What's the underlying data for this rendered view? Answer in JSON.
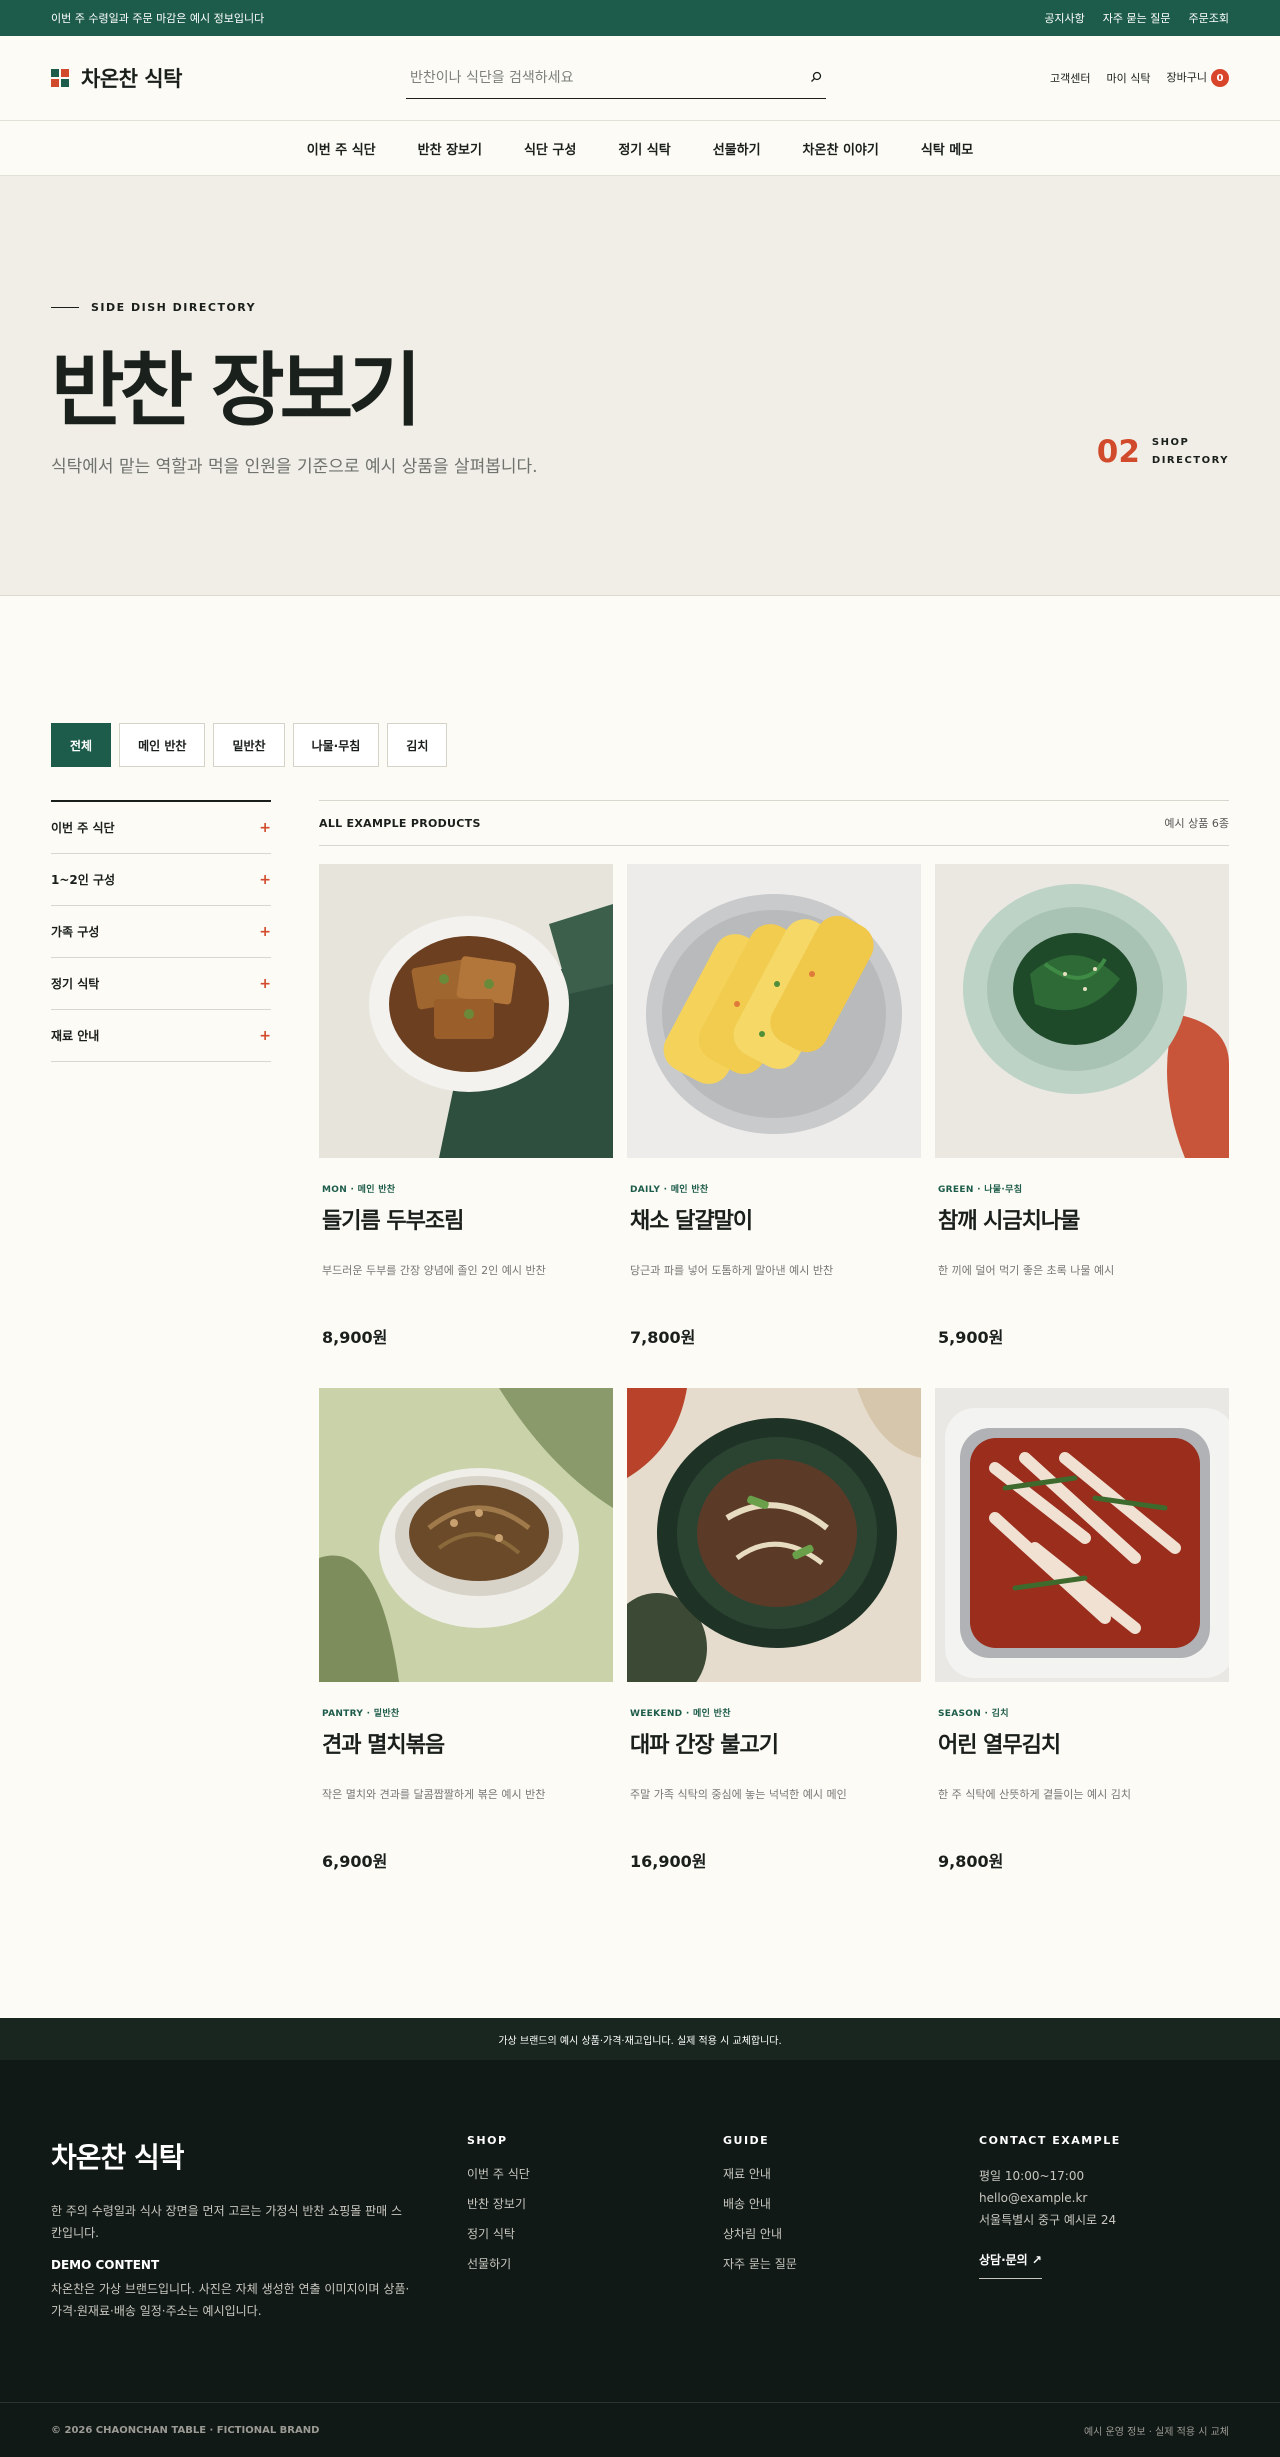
{
  "topbar": {
    "notice": "이번 주 수령일과 주문 마감은 예시 정보입니다",
    "links": [
      "공지사항",
      "자주 묻는 질문",
      "주문조회"
    ]
  },
  "header": {
    "logo": "차온찬 식탁",
    "search_placeholder": "반찬이나 식단을 검색하세요",
    "links": [
      "고객센터",
      "마이 식탁"
    ],
    "cart_label": "장바구니",
    "cart_count": "0"
  },
  "nav": [
    "이번 주 식단",
    "반찬 장보기",
    "식단 구성",
    "정기 식탁",
    "선물하기",
    "차온찬 이야기",
    "식탁 메모"
  ],
  "hero": {
    "eyebrow": "SIDE DISH DIRECTORY",
    "title": "반찬 장보기",
    "subtitle": "식탁에서 맡는 역할과 먹을 인원을 기준으로 예시 상품을 살펴봅니다.",
    "number": "02",
    "number_label_1": "SHOP",
    "number_label_2": "DIRECTORY"
  },
  "filters": [
    "전체",
    "메인 반찬",
    "밑반찬",
    "나물·무침",
    "김치"
  ],
  "sidebar": [
    "이번 주 식단",
    "1~2인 구성",
    "가족 구성",
    "정기 식탁",
    "재료 안내"
  ],
  "list": {
    "heading": "ALL EXAMPLE PRODUCTS",
    "count": "예시 상품 6종"
  },
  "products": [
    {
      "tag": "MON · 메인 반찬",
      "name": "들기름 두부조림",
      "desc": "부드러운 두부를 간장 양념에 졸인 2인 예시 반찬",
      "price": "8,900원",
      "image": "tofu-braised-dish"
    },
    {
      "tag": "DAILY · 메인 반찬",
      "name": "채소 달걀말이",
      "desc": "당근과 파를 넣어 도톰하게 말아낸 예시 반찬",
      "price": "7,800원",
      "image": "rolled-omelette-dish"
    },
    {
      "tag": "GREEN · 나물·무침",
      "name": "참깨 시금치나물",
      "desc": "한 끼에 덜어 먹기 좋은 초록 나물 예시",
      "price": "5,900원",
      "image": "spinach-namul-dish"
    },
    {
      "tag": "PANTRY · 밑반찬",
      "name": "견과 멸치볶음",
      "desc": "작은 멸치와 견과를 달콤짭짤하게 볶은 예시 반찬",
      "price": "6,900원",
      "image": "anchovy-stir-fry-dish"
    },
    {
      "tag": "WEEKEND · 메인 반찬",
      "name": "대파 간장 불고기",
      "desc": "주말 가족 식탁의 중심에 놓는 넉넉한 예시 메인",
      "price": "16,900원",
      "image": "bulgogi-dish"
    },
    {
      "tag": "SEASON · 김치",
      "name": "어린 열무김치",
      "desc": "한 주 식탁에 산뜻하게 곁들이는 예시 김치",
      "price": "9,800원",
      "image": "yeolmu-kimchi-dish"
    }
  ],
  "notice_bar": "가상 브랜드의 예시 상품·가격·재고입니다. 실제 적용 시 교체합니다.",
  "footer": {
    "brand": "차온찬 식탁",
    "desc": "한 주의 수령일과 식사 장면을 먼저 고르는 가정식 반찬 쇼핑몰 판매 스칸입니다.",
    "demo_title": "DEMO CONTENT",
    "demo_desc": "차온찬은 가상 브랜드입니다. 사진은 자체 생성한 연출 이미지이며 상품·가격·원재료·배송 일정·주소는 예시입니다.",
    "shop_title": "SHOP",
    "shop_items": [
      "이번 주 식단",
      "반찬 장보기",
      "정기 식탁",
      "선물하기"
    ],
    "guide_title": "GUIDE",
    "guide_items": [
      "재료 안내",
      "배송 안내",
      "상차림 안내",
      "자주 묻는 질문"
    ],
    "contact_title": "CONTACT EXAMPLE",
    "contact_hours": "평일 10:00~17:00",
    "contact_email": "hello@example.kr",
    "contact_address": "서울특별시 중구 예시로 24",
    "consult": "상담·문의",
    "copyright": "© 2026 CHAONCHAN TABLE · FICTIONAL BRAND",
    "bottom_right": "예시 운영 정보 · 실제 적용 시 교체"
  },
  "colors": {
    "primary": "#1d5c4a",
    "accent": "#d24a2c",
    "footer_bg": "#111916"
  }
}
